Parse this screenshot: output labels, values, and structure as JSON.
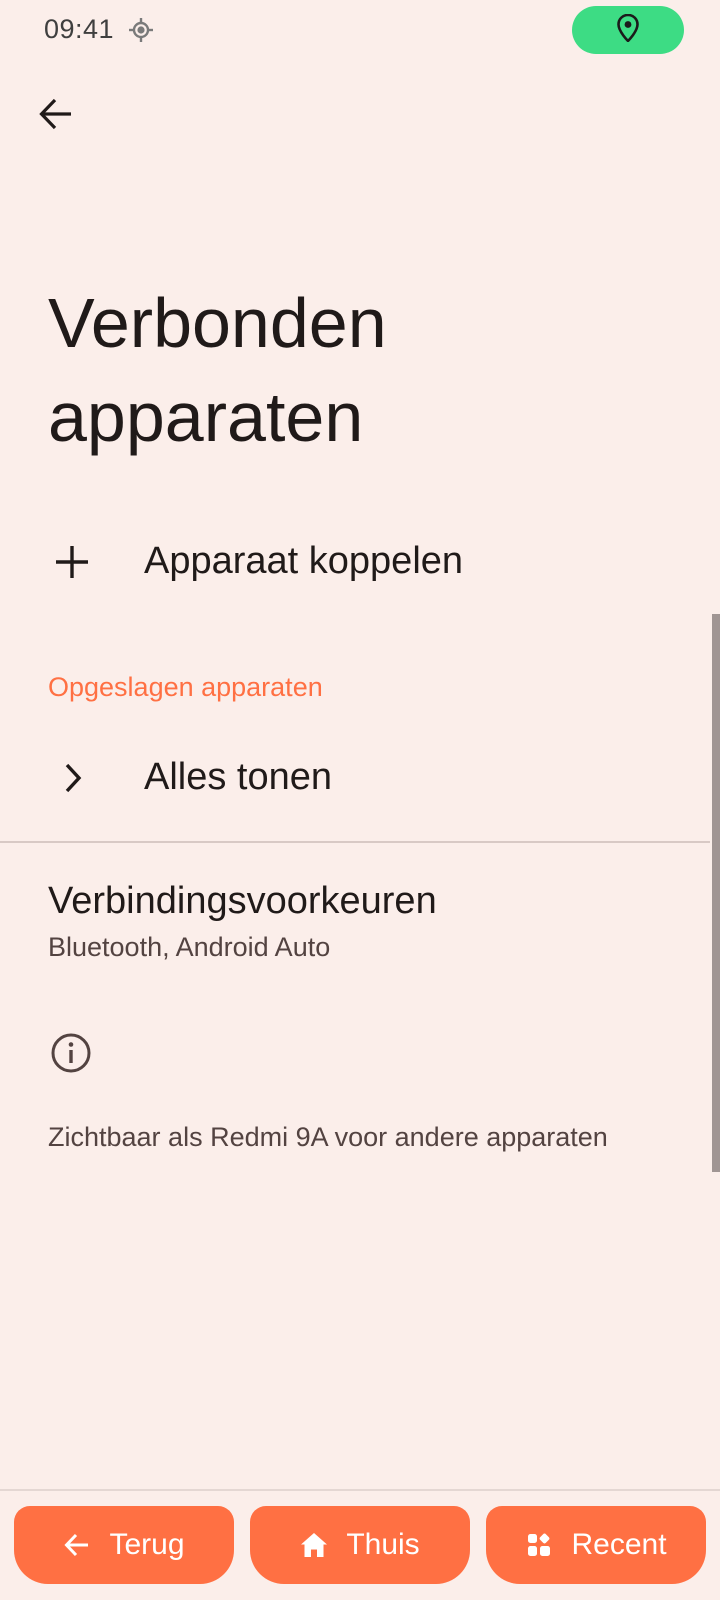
{
  "status_bar": {
    "time": "09:41",
    "location_icon": "crosshair-location-icon",
    "pill_icon": "map-pin-icon",
    "pill_color": "#3ddc84"
  },
  "header": {
    "back_icon": "arrow-left-icon"
  },
  "page": {
    "title": "Verbonden apparaten"
  },
  "pair_device": {
    "label": "Apparaat koppelen",
    "icon": "plus-icon"
  },
  "saved_devices": {
    "section_title": "Opgeslagen apparaten",
    "show_all_label": "Alles tonen",
    "show_all_icon": "chevron-right-icon"
  },
  "connection_prefs": {
    "title": "Verbindingsvoorkeuren",
    "subtitle": "Bluetooth, Android Auto"
  },
  "info": {
    "icon": "info-icon",
    "text": "Zichtbaar als Redmi 9A voor andere apparaten"
  },
  "nav": {
    "accent_color": "#ff7043",
    "back": {
      "label": "Terug",
      "icon": "arrow-left-icon"
    },
    "home": {
      "label": "Thuis",
      "icon": "home-icon"
    },
    "recent": {
      "label": "Recent",
      "icon": "grid-icon"
    }
  },
  "colors": {
    "background": "#fbeeea",
    "accent": "#ff7043",
    "text_primary": "#201a19",
    "text_secondary": "#534341"
  }
}
